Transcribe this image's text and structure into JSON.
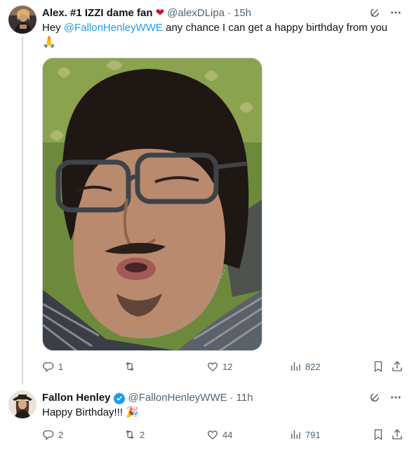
{
  "tweets": [
    {
      "author_name": "Alex. #1 IZZI dame fan",
      "name_emoji": "❤",
      "handle": "@alexDLipa",
      "separator": "·",
      "time": "15h",
      "text_before": "Hey ",
      "mention": "@FallonHenleyWWE",
      "text_after": " any chance I can get a happy birthday from you",
      "trailing_emoji": "🙏",
      "media_icon": "selfie-photo",
      "stats": {
        "replies": "1",
        "retweets": "",
        "likes": "12",
        "views": "822"
      }
    },
    {
      "author_name": "Fallon Henley",
      "verified": true,
      "handle": "@FallonHenleyWWE",
      "separator": "·",
      "time": "11h",
      "text": "Happy Birthday!!! 🎉",
      "stats": {
        "replies": "2",
        "retweets": "2",
        "likes": "44",
        "views": "791"
      }
    }
  ],
  "colors": {
    "link": "#1d9bf0",
    "muted": "#536471",
    "text": "#0f1419",
    "divider": "#cfd9de",
    "heart": "#c0152f",
    "verified": "#1d9bf0"
  },
  "icons": [
    "reply-icon",
    "retweet-icon",
    "like-icon",
    "views-icon",
    "bookmark-icon",
    "share-icon",
    "grok-icon",
    "more-icon",
    "verified-badge-icon"
  ]
}
